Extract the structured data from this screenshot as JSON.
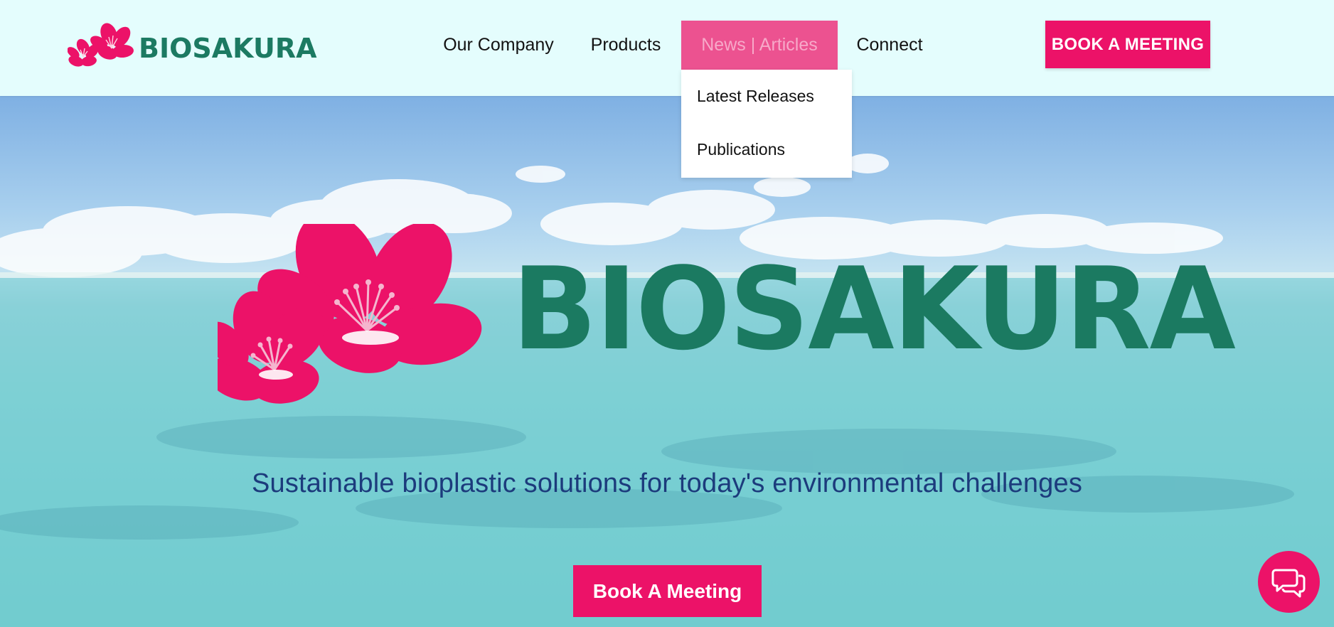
{
  "brand": {
    "name": "BIOSAKURA",
    "logo_icon": "sakura-flowers-icon",
    "colors": {
      "pink": "#ec1268",
      "green": "#1b7a61",
      "nav_active": "#ec5290",
      "navy": "#1c3b7c"
    }
  },
  "nav": {
    "items": [
      {
        "label": "Our Company"
      },
      {
        "label": "Products"
      },
      {
        "label": "News | Articles",
        "active": true
      },
      {
        "label": "Connect"
      }
    ],
    "dropdown": {
      "items": [
        {
          "label": "Latest Releases"
        },
        {
          "label": "Publications"
        }
      ]
    },
    "cta_label": "BOOK A MEETING"
  },
  "hero": {
    "background": "ocean-and-sky-photo",
    "tagline": "Sustainable bioplastic solutions for today's environmental challenges",
    "cta_label": "Book A Meeting"
  },
  "chat": {
    "icon": "chat-bubbles-icon"
  }
}
